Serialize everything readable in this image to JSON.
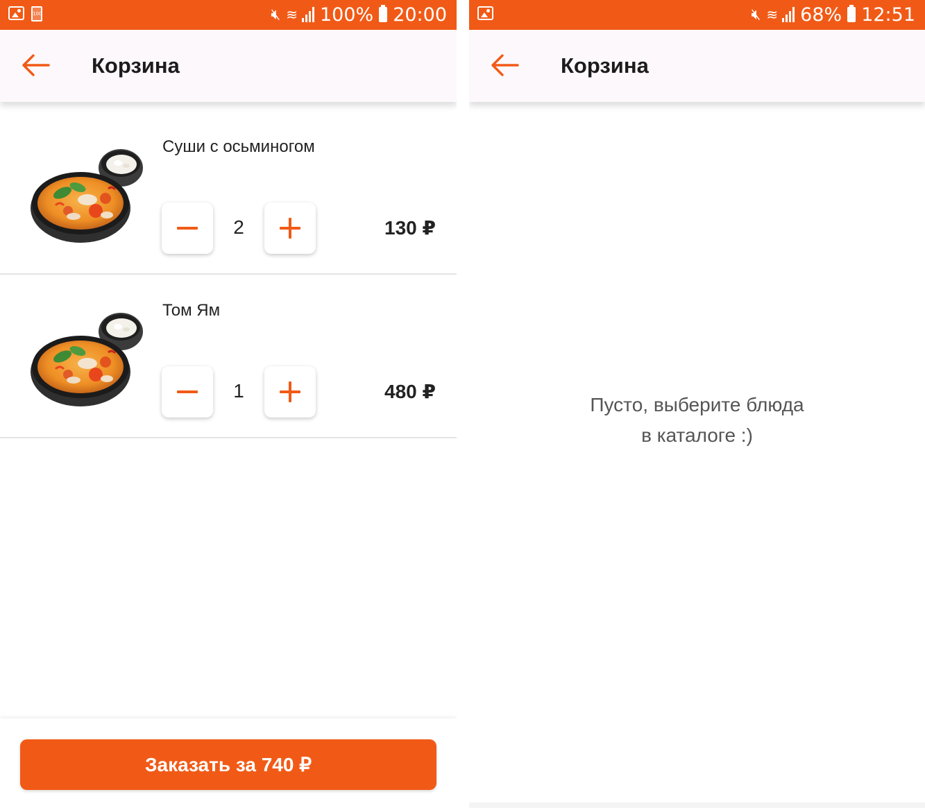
{
  "colors": {
    "accent": "#f15a16",
    "appbar_bg": "#fdf8fb",
    "text": "#222222"
  },
  "left_screen": {
    "status_bar": {
      "left_icons": [
        "image-notification-icon",
        "battery-full-notification-icon"
      ],
      "battery_badge": "100",
      "battery_percent": "100%",
      "time": "20:00"
    },
    "appbar": {
      "back_icon": "arrow-left-icon",
      "title": "Корзина"
    },
    "items": [
      {
        "name": "Суши с осьминогом",
        "quantity": "2",
        "price": "130 ₽",
        "image": "soup-bowl-with-rice"
      },
      {
        "name": "Том Ям",
        "quantity": "1",
        "price": "480 ₽",
        "image": "soup-bowl-with-rice"
      }
    ],
    "order_button": "Заказать за 740 ₽"
  },
  "right_screen": {
    "status_bar": {
      "left_icons": [
        "image-notification-icon"
      ],
      "battery_percent": "68%",
      "time": "12:51"
    },
    "appbar": {
      "back_icon": "arrow-left-icon",
      "title": "Корзина"
    },
    "empty_line1": "Пусто, выберите блюда",
    "empty_line2": "в каталоге :)"
  }
}
